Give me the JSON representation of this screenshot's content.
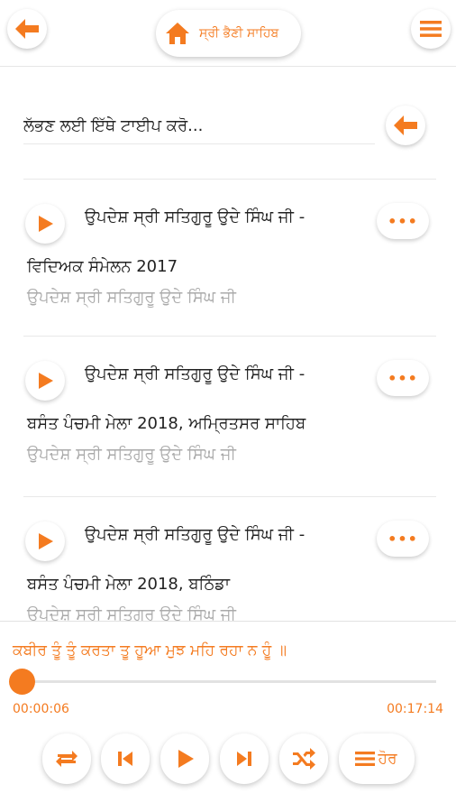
{
  "header": {
    "title": "ਸ੍ਰੀ ਭੈਣੀ ਸਾਹਿਬ",
    "back_icon": "arrow-left-icon",
    "home_icon": "home-icon",
    "menu_icon": "menu-icon"
  },
  "search": {
    "placeholder": "ਲੱਭਣ ਲਈ ਇੱਥੇ ਟਾਈਪ ਕਰੋ..."
  },
  "items": [
    {
      "title_line1": "ਉਪਦੇਸ਼ ਸ੍ਰੀ ਸਤਿਗੁਰੂ ਉਦੇ ਸਿੰਘ ਜੀ -",
      "title_line2": "ਵਿਦਿਅਕ ਸੰਮੇਲਨ 2017",
      "subtitle": "ਉਪਦੇਸ਼ ਸ੍ਰੀ ਸਤਿਗੁਰੂ ਉਦੇ ਸਿੰਘ ਜੀ",
      "more": "•••"
    },
    {
      "title_line1": "ਉਪਦੇਸ਼ ਸ੍ਰੀ ਸਤਿਗੁਰੂ ਉਦੇ ਸਿੰਘ ਜੀ -",
      "title_line2": "ਬਸੰਤ ਪੰਚਮੀ ਮੇਲਾ 2018, ਅਮ੍ਰਿਤਸਰ ਸਾਹਿਬ",
      "subtitle": "ਉਪਦੇਸ਼ ਸ੍ਰੀ ਸਤਿਗੁਰੂ ਉਦੇ ਸਿੰਘ ਜੀ",
      "more": "•••"
    },
    {
      "title_line1": "ਉਪਦੇਸ਼ ਸ੍ਰੀ ਸਤਿਗੁਰੂ ਉਦੇ ਸਿੰਘ ਜੀ -",
      "title_line2": "ਬਸੰਤ ਪੰਚਮੀ ਮੇਲਾ 2018, ਬਠਿੰਡਾ",
      "subtitle": "ਉਪਦੇਸ਼ ਸ੍ਰੀ ਸਤਿਗੁਰੂ ਉਦੇ ਸਿੰਘ ਜੀ",
      "more": "•••"
    }
  ],
  "player": {
    "now_playing": "ਕਬੀਰ ਤੂੰ ਤੂੰ ਕਰਤਾ ਤੂ ਹੂਆ ਮੁਝ ਮਹਿ ਰਹਾ ਨ ਹੂੰ ॥",
    "current_time": "00:00:06",
    "total_time": "00:17:14",
    "progress": 0.006,
    "more_label": "ਹੋਰ"
  },
  "colors": {
    "accent": "#f47b20",
    "muted": "#aaaaaa"
  }
}
